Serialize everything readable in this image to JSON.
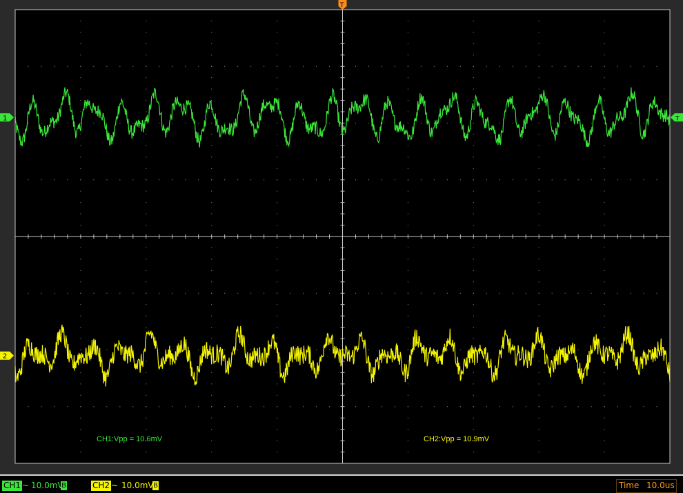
{
  "chart_data": {
    "type": "line",
    "title": "",
    "xlabel": "",
    "ylabel": "",
    "grid": true,
    "x_divisions": 10,
    "y_divisions": 8,
    "series": [
      {
        "name": "CH1",
        "color": "#39e639",
        "ref_div": 1.05,
        "vpp_div": 1.06,
        "label_text": "CH1:Vpp = 10.6mV",
        "marker": "1"
      },
      {
        "name": "CH2",
        "color": "#f5f500",
        "ref_div": -1.05,
        "vpp_div": 1.09,
        "label_text": "CH2:Vpp = 10.9mV",
        "marker": "2"
      }
    ],
    "trigger_marker": "T",
    "trigger_level_marker": "T"
  },
  "status_bar": {
    "ch1": {
      "label": "CH1",
      "coupling": "~",
      "scale": "10.0mV",
      "bw": "B"
    },
    "ch2": {
      "label": "CH2",
      "coupling": "~",
      "scale": "10.0mV",
      "bw": "B"
    },
    "time_label": "Time",
    "time_value": "10.0us"
  },
  "colors": {
    "ch1": "#39e639",
    "ch2": "#f5f500",
    "trigger": "#ff8c1a",
    "grid_frame": "#c8c8c8"
  }
}
